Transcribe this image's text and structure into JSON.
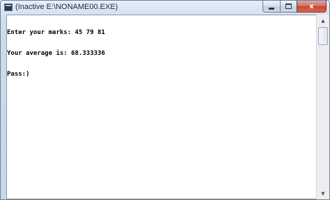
{
  "window": {
    "title": "(Inactive E:\\NONAME00.EXE)",
    "icon": "console-app-icon"
  },
  "caption_buttons": {
    "minimize": "minimize-icon",
    "maximize": "maximize-icon",
    "close": "close-icon",
    "close_glyph": "x"
  },
  "console": {
    "lines": [
      "Enter your marks: 45 79 81",
      "Your average is: 68.333336",
      "Pass:)"
    ]
  },
  "scrollbar": {
    "up_glyph": "▲",
    "down_glyph": "▼"
  }
}
